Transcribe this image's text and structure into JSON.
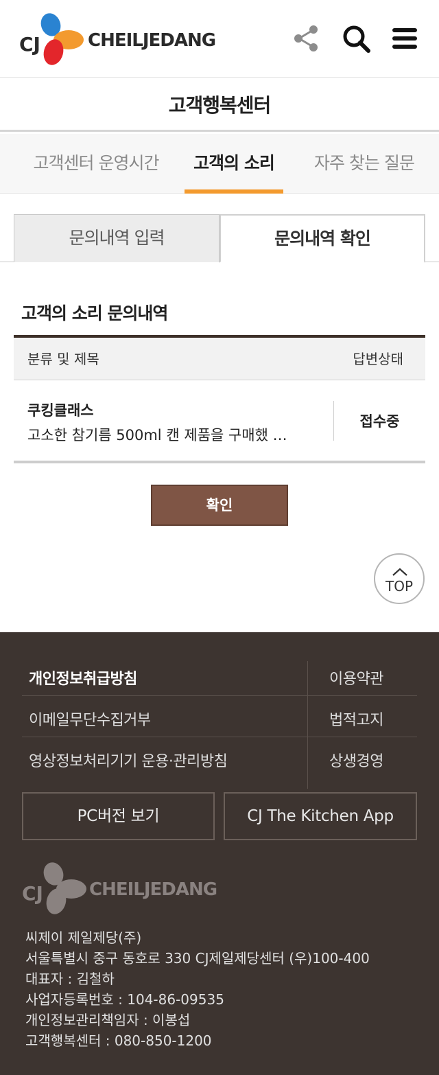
{
  "header": {
    "logo_cj": "CJ",
    "logo_text": "CHEILJEDANG",
    "icons": [
      "share-icon",
      "search-icon",
      "menu-icon"
    ]
  },
  "page_title": "고객행복센터",
  "main_tabs": [
    {
      "label": "고객센터 운영시간",
      "active": false
    },
    {
      "label": "고객의 소리",
      "active": true
    },
    {
      "label": "자주 찾는 질문",
      "active": false
    }
  ],
  "sub_tabs": [
    {
      "label": "문의내역 입력",
      "active": false
    },
    {
      "label": "문의내역 확인",
      "active": true
    }
  ],
  "section_title": "고객의 소리 문의내역",
  "table": {
    "col_subject": "분류 및 제목",
    "col_status": "답변상태",
    "rows": [
      {
        "category": "쿠킹클래스",
        "title": "고소한 참기름 500ml 캔 제품을 구매했 …",
        "status": "접수중"
      }
    ]
  },
  "confirm_label": "확인",
  "top_label": "TOP",
  "footer": {
    "links": {
      "privacy": "개인정보취급방침",
      "terms": "이용약관",
      "email_refusal": "이메일무단수집거부",
      "legal": "법적고지",
      "cctv": "영상정보처리기기 운용·관리방침",
      "coexistence": "상생경영"
    },
    "pc_version": "PC버전 보기",
    "app": "CJ The Kitchen App",
    "logo_text": "CHEILJEDANG",
    "logo_cj": "CJ",
    "info": [
      "씨제이 제일제당(주)",
      "서울특별시 중구 동호로 330 CJ제일제당센터 (우)100-400",
      "대표자 : 김철하",
      "사업자등록번호 : 104-86-09535",
      "개인정보관리책임자 : 이봉섭",
      "고객행복센터 : 080-850-1200"
    ]
  },
  "colors": {
    "accent_orange": "#f39a2e",
    "brown_button": "#7f5545",
    "footer_bg": "#3d3430",
    "logo_red": "#e3262b",
    "logo_orange": "#f39a2e",
    "logo_blue": "#2a83d1"
  }
}
